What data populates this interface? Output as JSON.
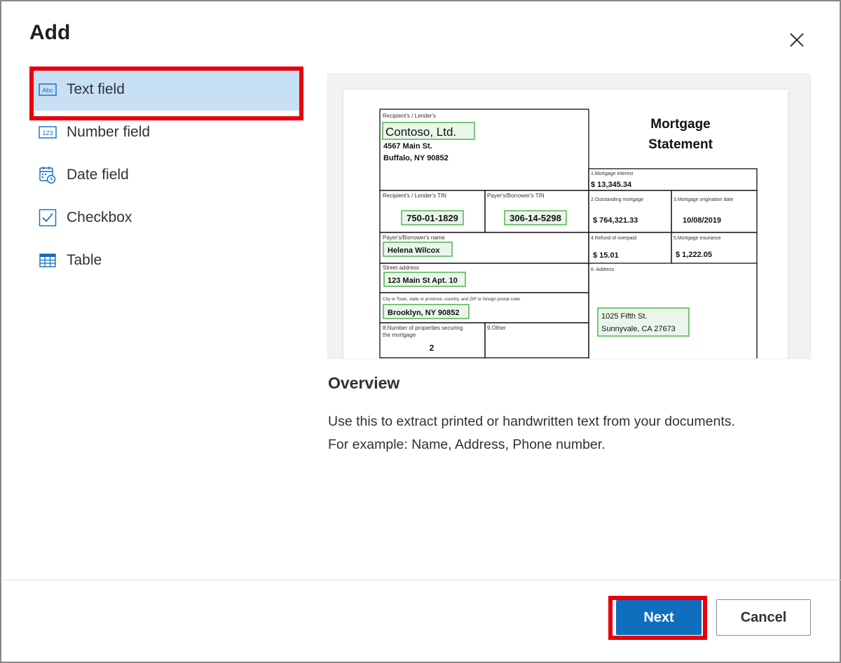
{
  "dialog": {
    "title": "Add",
    "close_icon": "close-icon"
  },
  "fields": [
    {
      "label": "Text field",
      "icon": "text-field-icon",
      "selected": true
    },
    {
      "label": "Number field",
      "icon": "number-field-icon",
      "selected": false
    },
    {
      "label": "Date field",
      "icon": "date-field-icon",
      "selected": false
    },
    {
      "label": "Checkbox",
      "icon": "checkbox-icon",
      "selected": false
    },
    {
      "label": "Table",
      "icon": "table-icon",
      "selected": false
    }
  ],
  "icon_glyphs": {
    "text": "Abc",
    "number": "123"
  },
  "preview_doc": {
    "title_line1": "Mortgage",
    "title_line2": "Statement",
    "recipient_label": "Recipient's / Lender's",
    "company": "Contoso, Ltd.",
    "address1": "4567 Main St.",
    "address2": "Buffalo, NY 90852",
    "recipient_tin_label": "Recipient's / Lender's TIN",
    "recipient_tin": "750-01-1829",
    "payer_tin_label": "Payer's/Borrower's TIN",
    "payer_tin": "306-14-5298",
    "payer_name_label": "Payer's/Borrower's name",
    "payer_name": "Helena Wilcox",
    "street_label": "Street address",
    "street": "123 Main St Apt. 10",
    "city_label": "City or Town, state or province, country, and ZIP or foreign postal code",
    "city": "Brooklyn, NY 90852",
    "properties_label_1": "8.Number of properties securing",
    "properties_label_2": "the mortgage",
    "properties": "2",
    "other_label": "9.Other",
    "interest_label": "1.Mortgage interest",
    "interest": "$  13,345.34",
    "outstanding_label": "2.Outstanding mortgage",
    "outstanding": "$  764,321.33",
    "origination_label": "3.Mortgage origination date",
    "origination": "10/08/2019",
    "refund_label": "4.Refund of overpaid",
    "refund": "$  15.01",
    "insurance_label": "5.Mortgage insurance",
    "insurance": "$  1,222.05",
    "address_label": "6. Address",
    "address_line1": "1025 Fifth St.",
    "address_line2": "Sunnyvale, CA 27673"
  },
  "overview": {
    "heading": "Overview",
    "text_line1": "Use this to extract printed or handwritten text from your documents.",
    "text_line2": "For example: Name, Address, Phone number."
  },
  "buttons": {
    "next": "Next",
    "cancel": "Cancel"
  },
  "colors": {
    "selected_bg": "#c7e0f4",
    "highlight": "#e8000b",
    "primary": "#106ebe",
    "field_box": "#5cb85c"
  }
}
